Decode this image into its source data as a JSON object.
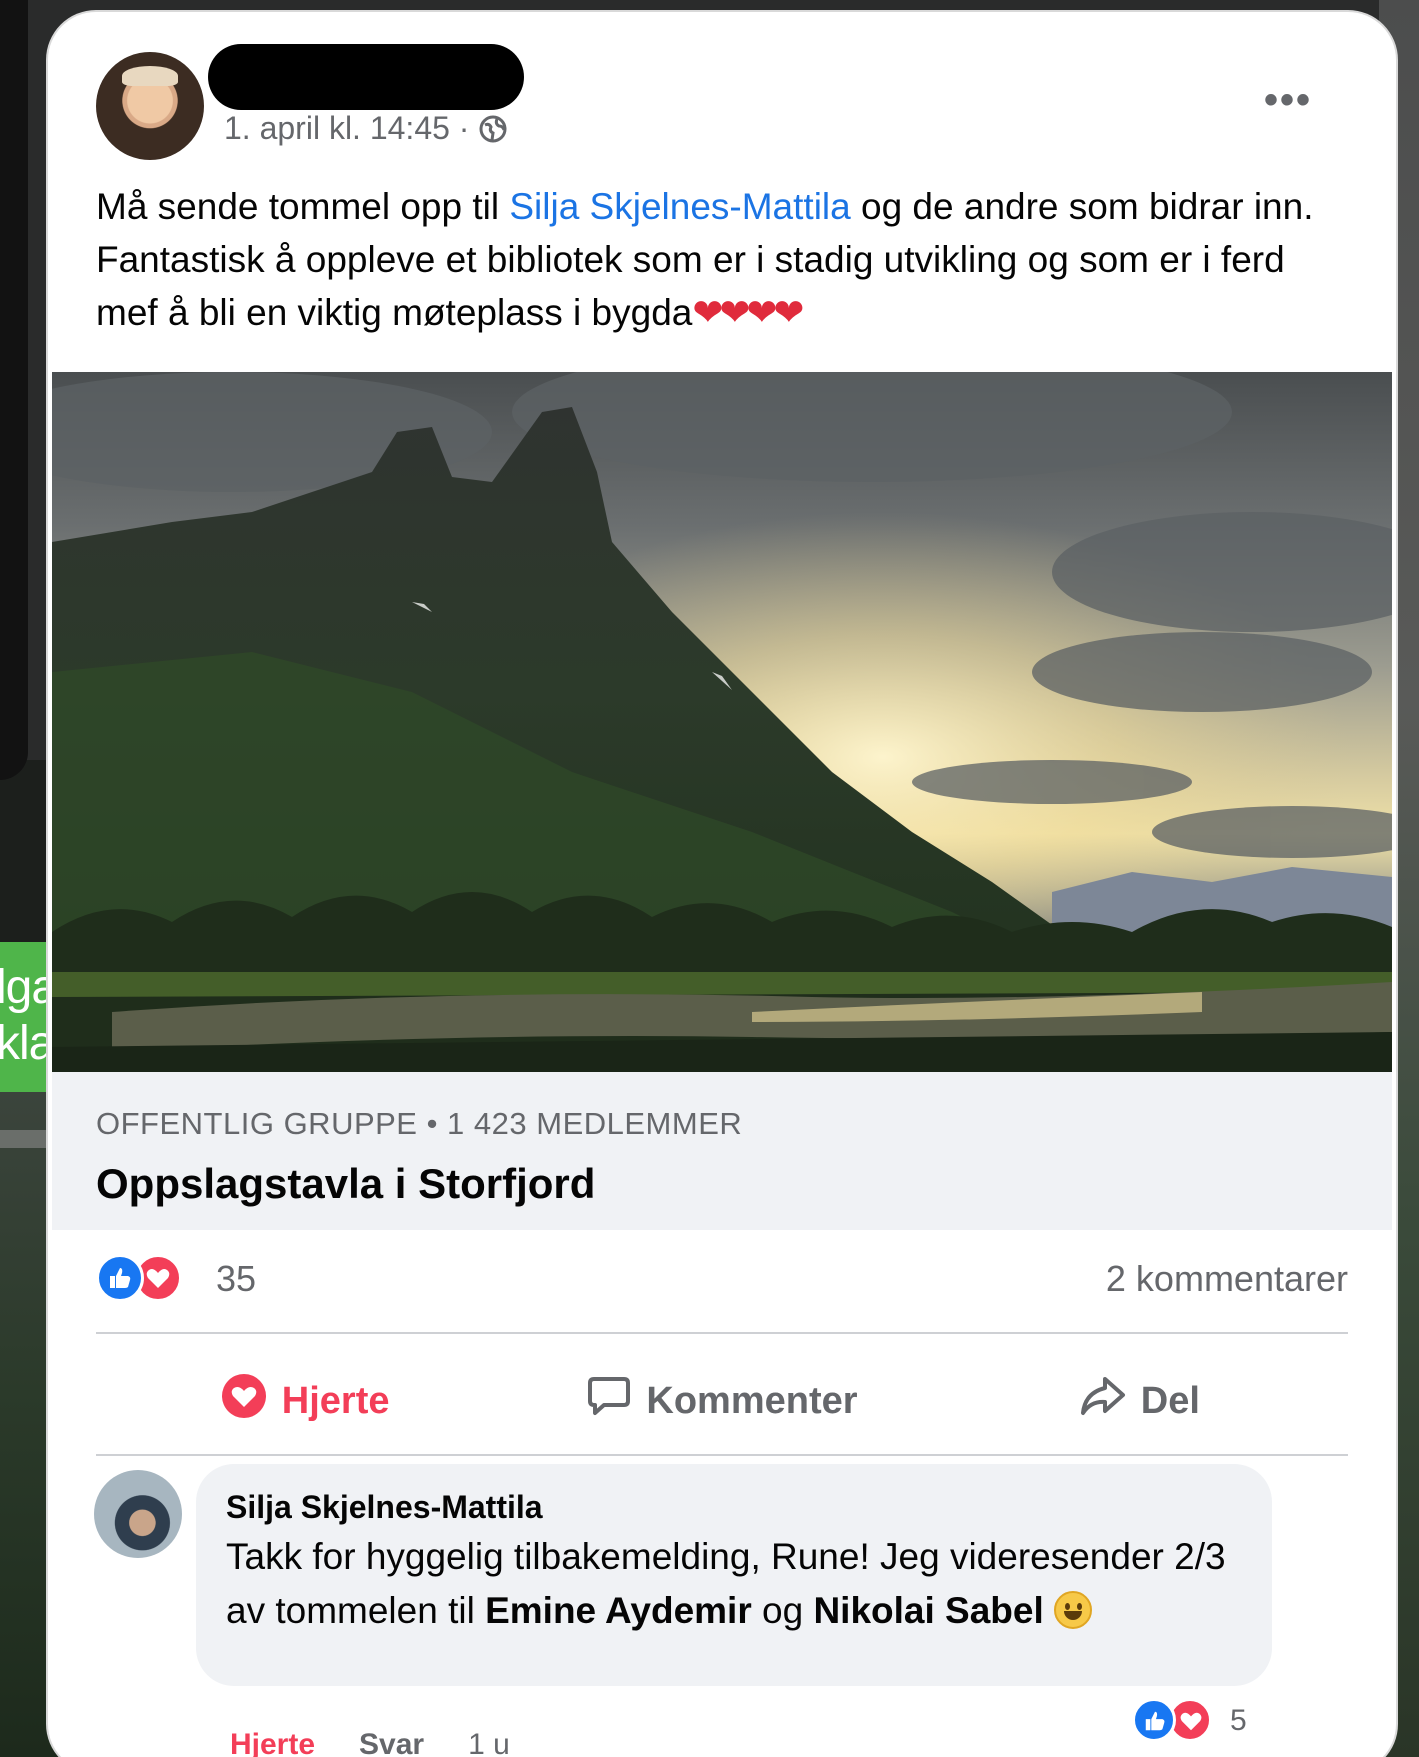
{
  "background": {
    "side_text_lines": [
      "lga",
      "kla"
    ]
  },
  "post": {
    "timestamp": "1. april kl. 14:45 ·",
    "text_before": "Må sende tommel opp til ",
    "mention": "Silja Skjelnes-Mattila",
    "text_after": " og de andre som bidrar inn. Fantastisk å oppleve et bibliotek som er i stadig utvikling og som er i ferd mef å bli en viktig møteplass i bygda",
    "hearts": "❤❤❤❤",
    "more_icon": "•••"
  },
  "group": {
    "subtitle": "OFFENTLIG GRUPPE • 1 423 MEDLEMMER",
    "name": "Oppslagstavla i Storfjord"
  },
  "reactions": {
    "count": "35",
    "comments": "2 kommentarer"
  },
  "actions": {
    "heart": "Hjerte",
    "comment": "Kommenter",
    "share": "Del"
  },
  "comment": {
    "author": "Silja Skjelnes-Mattila",
    "text_1": "Takk for hyggelig tilbakemelding, Rune! Jeg videresender 2/3 av tommelen til ",
    "name_1": "Emine Aydemir",
    "text_2": " og ",
    "name_2": "Nikolai Sabel",
    "reaction_count": "5",
    "heart_label": "Hjerte",
    "reply_label": "Svar",
    "time": "1 u"
  },
  "colors": {
    "accent_blue": "#1b74e4",
    "love_red": "#f33e58",
    "meta_gray": "#65676b"
  }
}
